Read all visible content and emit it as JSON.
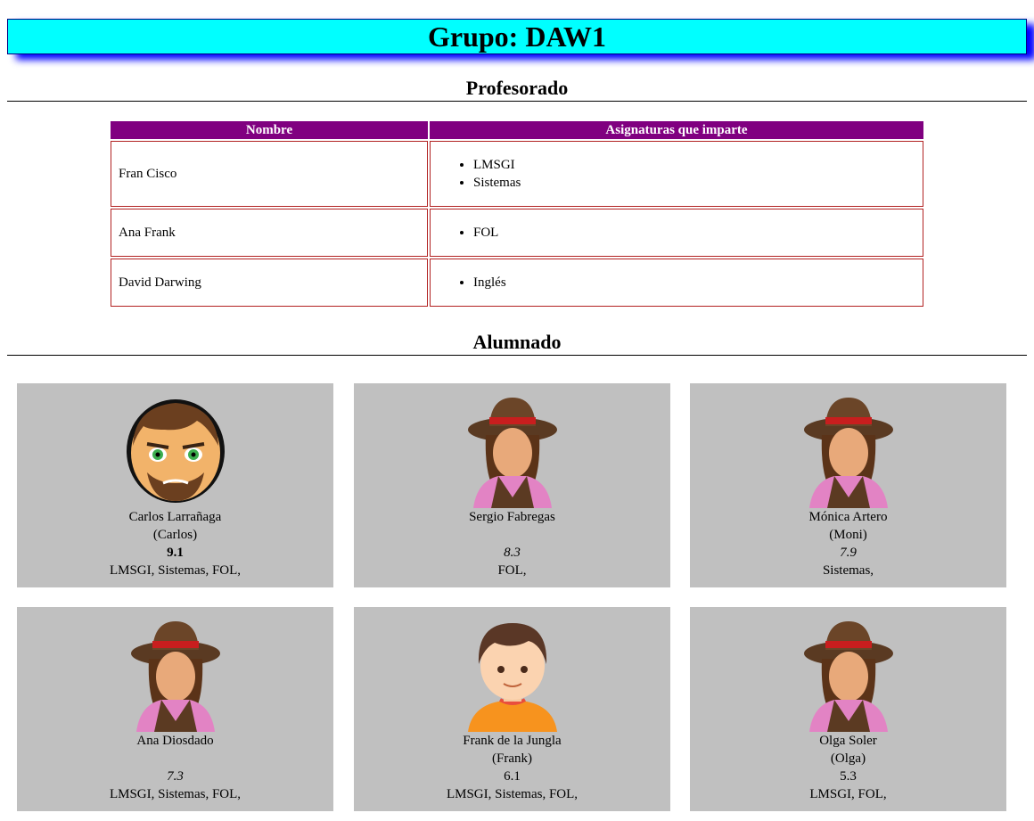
{
  "header": {
    "title": "Grupo: DAW1"
  },
  "profesorado": {
    "heading": "Profesorado",
    "columns": [
      "Nombre",
      "Asignaturas que imparte"
    ],
    "rows": [
      {
        "name": "Fran Cisco",
        "subjects": [
          "LMSGI",
          "Sistemas"
        ]
      },
      {
        "name": "Ana Frank",
        "subjects": [
          "FOL"
        ]
      },
      {
        "name": "David Darwing",
        "subjects": [
          "Inglés"
        ]
      }
    ]
  },
  "alumnado": {
    "heading": "Alumnado",
    "students": [
      {
        "name": "Carlos Larrañaga",
        "nick": "(Carlos)",
        "grade": "9.1",
        "grade_style": "bold",
        "subjects": "LMSGI, Sistemas, FOL,",
        "avatar": "bearded-man-icon"
      },
      {
        "name": "Sergio Fabregas",
        "nick": "",
        "grade": "8.3",
        "grade_style": "italic",
        "subjects": "FOL,",
        "avatar": "cowgirl-icon"
      },
      {
        "name": "Mónica Artero",
        "nick": "(Moni)",
        "grade": "7.9",
        "grade_style": "italic",
        "subjects": "Sistemas,",
        "avatar": "cowgirl-icon"
      },
      {
        "name": "Ana Diosdado",
        "nick": "",
        "grade": "7.3",
        "grade_style": "italic",
        "subjects": "LMSGI, Sistemas, FOL,",
        "avatar": "cowgirl-icon"
      },
      {
        "name": "Frank de la Jungla",
        "nick": "(Frank)",
        "grade": "6.1",
        "grade_style": "normal",
        "subjects": "LMSGI, Sistemas, FOL,",
        "avatar": "boy-icon"
      },
      {
        "name": "Olga Soler",
        "nick": "(Olga)",
        "grade": "5.3",
        "grade_style": "normal",
        "subjects": "LMSGI, FOL,",
        "avatar": "cowgirl-icon"
      }
    ]
  },
  "colors": {
    "title_bg": "#00ffff",
    "table_header": "#800080",
    "card_bg": "#c0c0c0",
    "cell_border": "#b22222"
  }
}
